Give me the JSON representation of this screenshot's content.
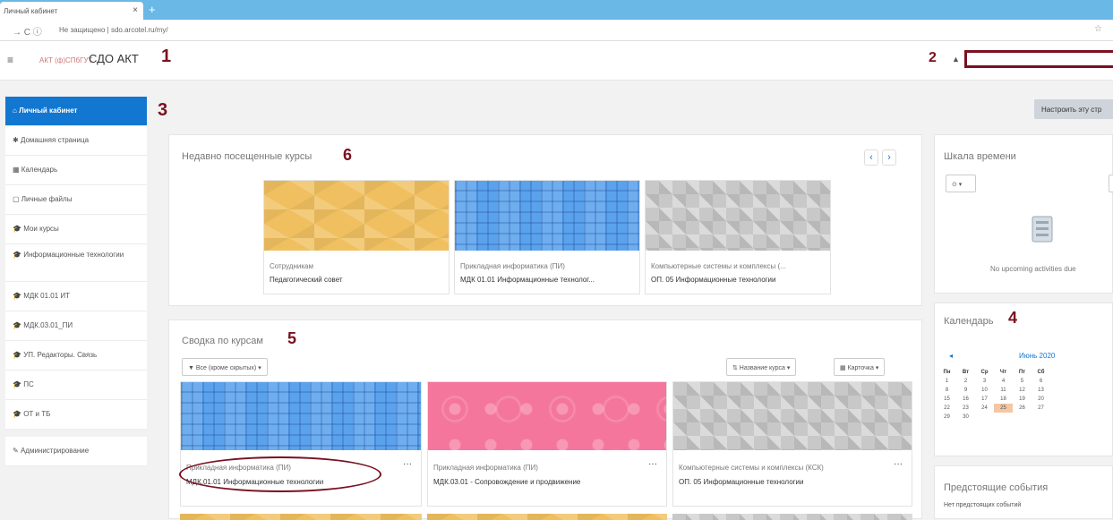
{
  "browser": {
    "tab_title": "Личный кабинет",
    "tab_close": "×",
    "new_tab": "+",
    "nav_glyphs": "→ C ⓘ",
    "url_prefix": "Не защищено",
    "url": "sdo.arcotel.ru/my/",
    "star": "☆"
  },
  "header": {
    "menu_icon": "≡",
    "logo_text": "АКТ (ф)СПбГУТ",
    "brand": "СДО АКТ",
    "bell_icon": "▲"
  },
  "annotations": [
    "1",
    "2",
    "3",
    "4",
    "5",
    "6"
  ],
  "sidebar": {
    "items": [
      {
        "label": "Личный кабинет"
      },
      {
        "label": "Домашняя страница"
      },
      {
        "label": "Календарь"
      },
      {
        "label": "Личные файлы"
      },
      {
        "label": "Мои курсы"
      },
      {
        "label": "Информационные технологии"
      },
      {
        "label": "МДК 01.01 ИТ"
      },
      {
        "label": "МДК.03.01_ПИ"
      },
      {
        "label": "УП. Редакторы. Связь"
      },
      {
        "label": "ПС"
      },
      {
        "label": "ОТ и ТБ"
      },
      {
        "label": "Администрирование"
      }
    ],
    "icons": [
      "⌂",
      "✱",
      "▦",
      "▢",
      "🎓",
      "🎓",
      "🎓",
      "🎓",
      "🎓",
      "🎓",
      "🎓",
      "✎"
    ]
  },
  "page": {
    "customize_button": "Настроить эту стр"
  },
  "recent": {
    "title": "Недавно посещенные курсы",
    "prev": "‹",
    "next": "›",
    "courses": [
      {
        "category": "Сотрудникам",
        "name": "Педагогический совет"
      },
      {
        "category": "Прикладная информатика (ПИ)",
        "name": "МДК 01.01 Информационные технолог..."
      },
      {
        "category": "Компьютерные системы и комплексы (...",
        "name": "ОП. 05 Информационные технологии"
      }
    ]
  },
  "overview": {
    "title": "Сводка по курсам",
    "filter": "▼ Все (кроме скрытых) ▾",
    "sort": "⇅ Название курса ▾",
    "view": "▦ Карточка ▾",
    "dots": "···",
    "courses": [
      {
        "category": "Прикладная информатика (ПИ)",
        "name": "МДК.01.01 Информационные технологии"
      },
      {
        "category": "Прикладная информатика (ПИ)",
        "name": "МДК.03.01 - Сопровождение и продвижение"
      },
      {
        "category": "Компьютерные системы и комплексы (КСК)",
        "name": "ОП. 05 Информационные технологии"
      }
    ]
  },
  "timeline": {
    "title": "Шкала времени",
    "filter": "⊙ ▾",
    "empty": "No upcoming activities due"
  },
  "calendar": {
    "title": "Календарь",
    "prev": "◂",
    "month": "Июнь 2020",
    "weekdays": [
      "Пн",
      "Вт",
      "Ср",
      "Чт",
      "Пт",
      "Сб"
    ],
    "weeks": [
      [
        "1",
        "2",
        "3",
        "4",
        "5",
        "6"
      ],
      [
        "8",
        "9",
        "10",
        "11",
        "12",
        "13"
      ],
      [
        "15",
        "16",
        "17",
        "18",
        "19",
        "20"
      ],
      [
        "22",
        "23",
        "24",
        "25",
        "26",
        "27"
      ],
      [
        "29",
        "30",
        "",
        "",
        "",
        ""
      ]
    ],
    "today": "25"
  },
  "upcoming": {
    "title": "Предстоящие события",
    "empty": "Нет предстоящих событий"
  },
  "colors": {
    "accent": "#1177d1",
    "annotation": "#7a1020"
  }
}
